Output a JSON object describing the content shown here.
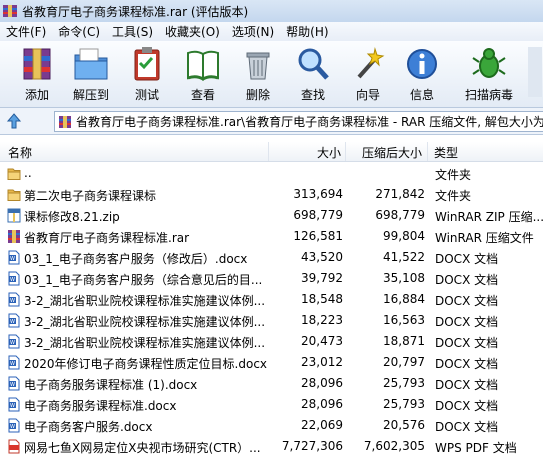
{
  "window": {
    "title": "省教育厅电子商务课程标准.rar (评估版本)"
  },
  "menu": [
    "文件(F)",
    "命令(C)",
    "工具(S)",
    "收藏夹(O)",
    "选项(N)",
    "帮助(H)"
  ],
  "toolbar": [
    {
      "label": "添加",
      "icon": "add-archive-icon"
    },
    {
      "label": "解压到",
      "icon": "extract-folder-icon"
    },
    {
      "label": "测试",
      "icon": "test-clipboard-icon"
    },
    {
      "label": "查看",
      "icon": "view-book-icon"
    },
    {
      "label": "删除",
      "icon": "trash-icon"
    },
    {
      "label": "查找",
      "icon": "magnifier-icon"
    },
    {
      "label": "向导",
      "icon": "wizard-wand-icon"
    },
    {
      "label": "信息",
      "icon": "info-icon"
    },
    {
      "label": "扫描病毒",
      "icon": "bug-scan-icon"
    }
  ],
  "address": {
    "path": "省教育厅电子商务课程标准.rar\\省教育厅电子商务课程标准 - RAR 压缩文件, 解包大小为"
  },
  "columns": {
    "name": "名称",
    "size": "大小",
    "packed": "压缩后大小",
    "type": "类型"
  },
  "rows": [
    {
      "name": "..",
      "size": "",
      "packed": "",
      "type": "文件夹",
      "icon": "folder-up"
    },
    {
      "name": "第二次电子商务课程课标",
      "size": "313,694",
      "packed": "271,842",
      "type": "文件夹",
      "icon": "folder"
    },
    {
      "name": "课标修改8.21.zip",
      "size": "698,779",
      "packed": "698,779",
      "type": "WinRAR ZIP 压缩...",
      "icon": "zip"
    },
    {
      "name": "省教育厅电子商务课程标准.rar",
      "size": "126,581",
      "packed": "99,804",
      "type": "WinRAR 压缩文件",
      "icon": "rar"
    },
    {
      "name": "03_1_电子商务客户服务（修改后）.docx",
      "size": "43,520",
      "packed": "41,522",
      "type": "DOCX 文档",
      "icon": "docx"
    },
    {
      "name": "03_1_电子商务客户服务（综合意见后的目...",
      "size": "39,792",
      "packed": "35,108",
      "type": "DOCX 文档",
      "icon": "docx"
    },
    {
      "name": "3-2_湖北省职业院校课程标准实施建议体例...",
      "size": "18,548",
      "packed": "16,884",
      "type": "DOCX 文档",
      "icon": "docx"
    },
    {
      "name": "3-2_湖北省职业院校课程标准实施建议体例...",
      "size": "18,223",
      "packed": "16,563",
      "type": "DOCX 文档",
      "icon": "docx"
    },
    {
      "name": "3-2_湖北省职业院校课程标准实施建议体例...",
      "size": "20,473",
      "packed": "18,871",
      "type": "DOCX 文档",
      "icon": "docx"
    },
    {
      "name": "2020年修订电子商务课程性质定位目标.docx",
      "size": "23,012",
      "packed": "20,797",
      "type": "DOCX 文档",
      "icon": "docx"
    },
    {
      "name": "电子商务服务课程标准 (1).docx",
      "size": "28,096",
      "packed": "25,793",
      "type": "DOCX 文档",
      "icon": "docx"
    },
    {
      "name": "电子商务服务课程标准.docx",
      "size": "28,096",
      "packed": "25,793",
      "type": "DOCX 文档",
      "icon": "docx"
    },
    {
      "name": "电子商务客户服务.docx",
      "size": "22,069",
      "packed": "20,576",
      "type": "DOCX 文档",
      "icon": "docx"
    },
    {
      "name": "网易七鱼X网易定位X央视市场研究(CTR）...",
      "size": "7,727,306",
      "packed": "7,602,305",
      "type": "WPS PDF 文档",
      "icon": "pdf"
    }
  ]
}
